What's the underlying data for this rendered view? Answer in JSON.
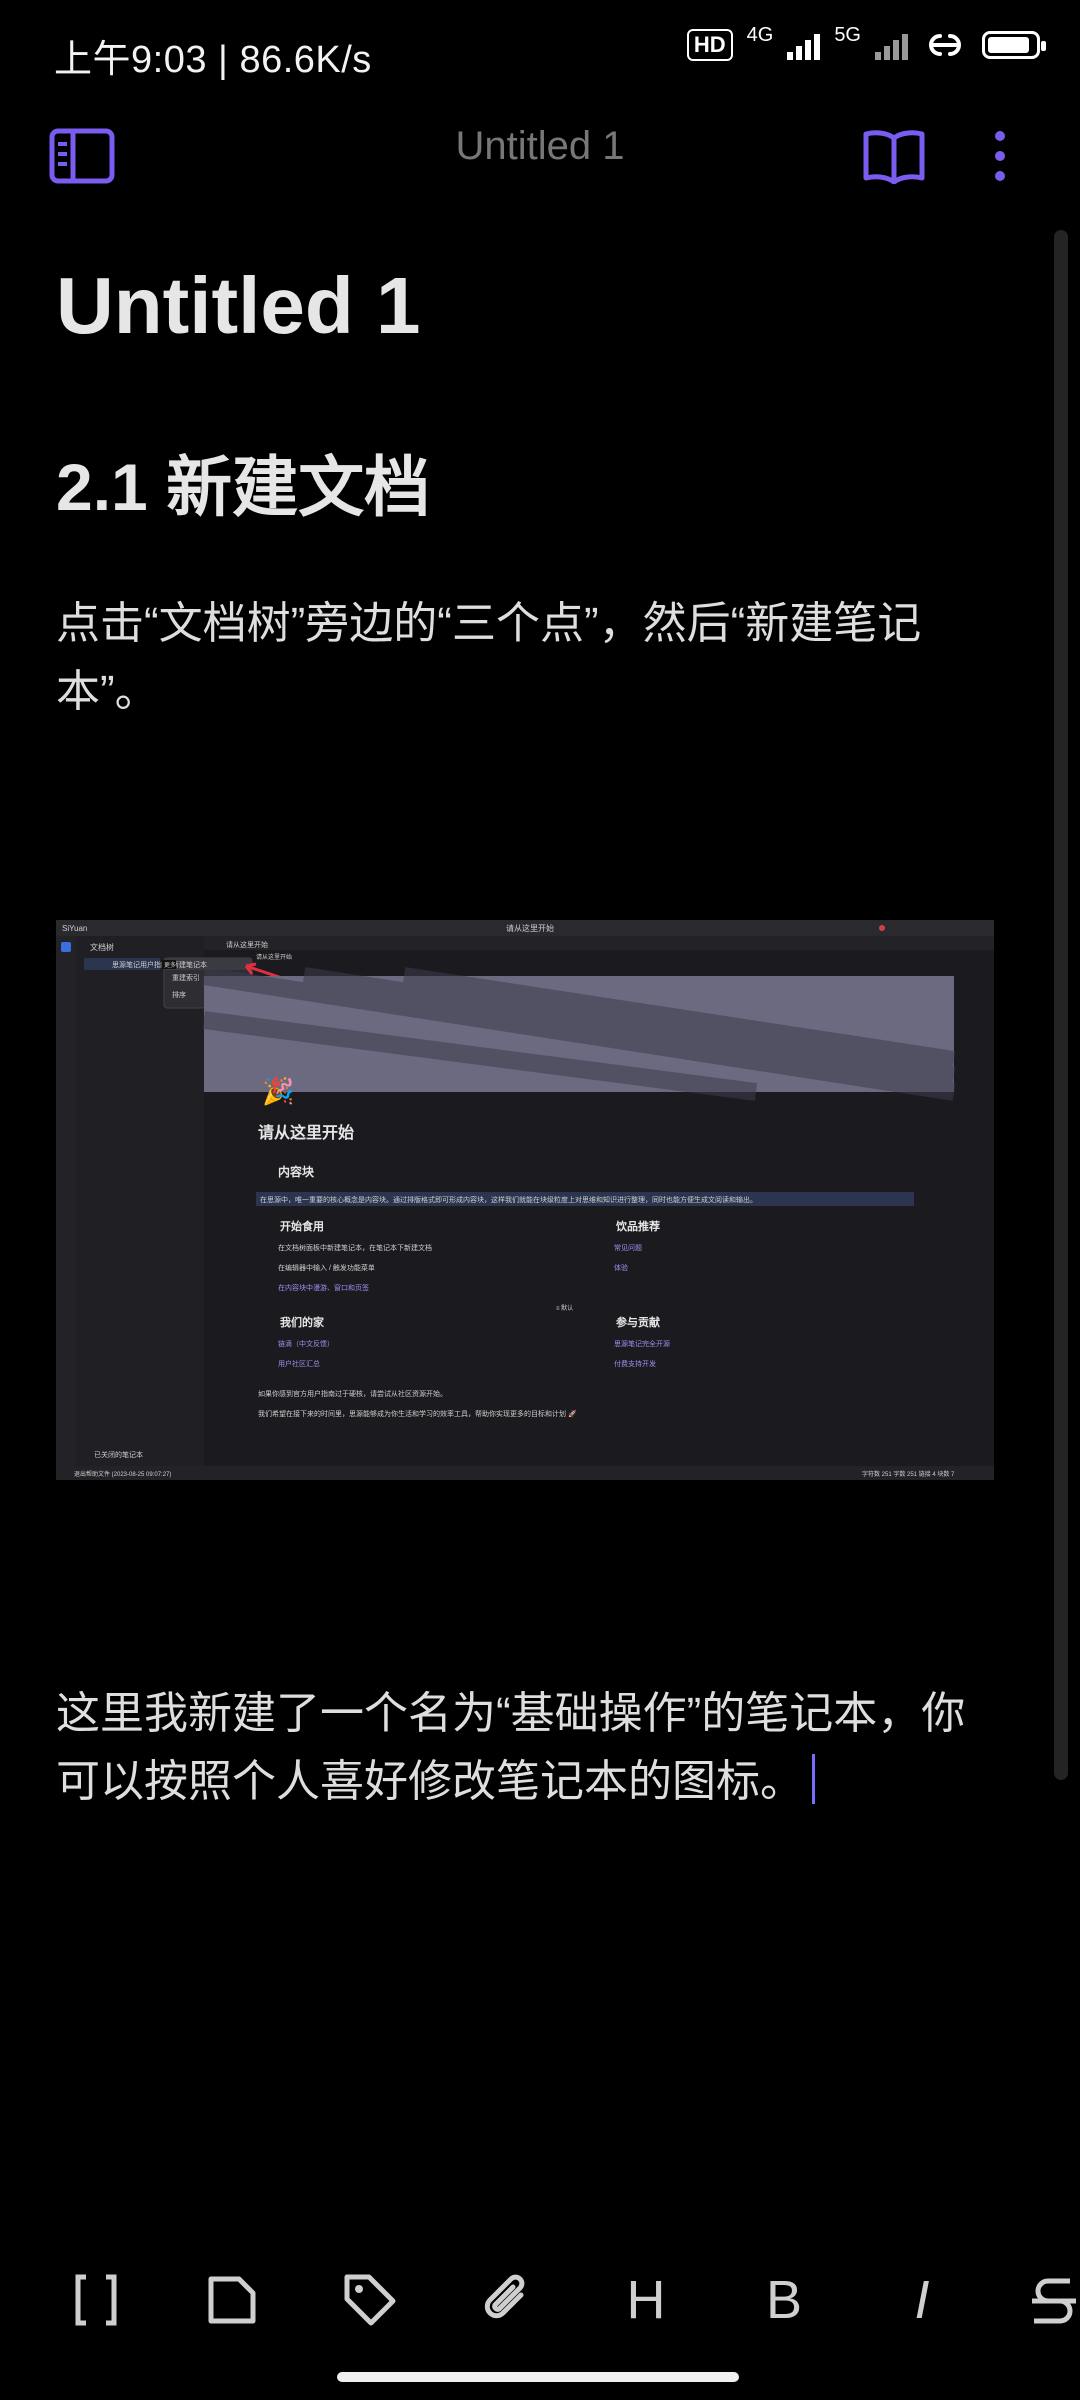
{
  "status_bar": {
    "time_speed": "上午9:03 | 86.6K/s",
    "hd_badge": "HD",
    "net_4g": "4G",
    "net_5g": "5G",
    "battery_level": 0.9
  },
  "top_bar": {
    "title": "Untitled 1"
  },
  "document": {
    "title": "Untitled 1",
    "heading": "2.1 新建文档",
    "paragraph1": "点击“文档树”旁边的“三个点”，然后“新建笔记本”。",
    "paragraph2": "这里我新建了一个名为“基础操作”的笔记本，你可以按照个人喜好修改笔记本的图标。"
  },
  "embedded_screenshot": {
    "app_menu": "SiYuan",
    "window_title": "请从这里开始",
    "sidebar_tab": "文档树",
    "notebook_item": "思源笔记用户指南",
    "popup": [
      "新建笔记本",
      "新建笔记本",
      "重建索引",
      "排序"
    ],
    "tooltip": "更多",
    "doc_tab": "请从这里开始",
    "breadcrumb": "请从这里开始",
    "doc_title": "请从这里开始",
    "section_content": "内容块",
    "content_text": "在思源中，唯一重要的核心概念是内容块。通过排版格式即可形成内容块，这样我们就能在块级粒度上对思维和知识进行整理，同时也能方便生成文阅读和输出。",
    "start_title": "开始食用",
    "start_items": [
      "在文档树面板中新建笔记本，在笔记本下新建文档",
      "在编辑器中输入 / 触发功能菜单",
      "在内容块中漫游、窗口和页签"
    ],
    "drinks_title": "饮品推荐",
    "drinks_items": [
      "常见问题",
      "体验"
    ],
    "home_title": "我们的家",
    "home_items": [
      "链滴（中文反馈）",
      "用户社区汇总"
    ],
    "contrib_title": "参与贡献",
    "contrib_items": [
      "思源笔记完全开源",
      "付费支持开发"
    ],
    "outro1": "如果你感到官方用户指南过于硬核，请尝试从社区资源开始。",
    "outro2": "我们希望在接下来的时间里，思源能够成为你生活和学习的效率工具，帮助你实现更多的目标和计划 🚀",
    "closed_notebooks": "已关闭的笔记本",
    "statusbar_left": "退出帮助文件 (2023-08-25 09:07:27)",
    "statusbar_right": "字符数 251  字数 251  链接 4  块数 7",
    "view_toggle": "≡ 默认"
  },
  "toolbar": {
    "heading_btn": "H",
    "bold_btn": "B",
    "italic_btn": "I"
  },
  "colors": {
    "accent": "#7b5cf0",
    "background": "#000000"
  }
}
